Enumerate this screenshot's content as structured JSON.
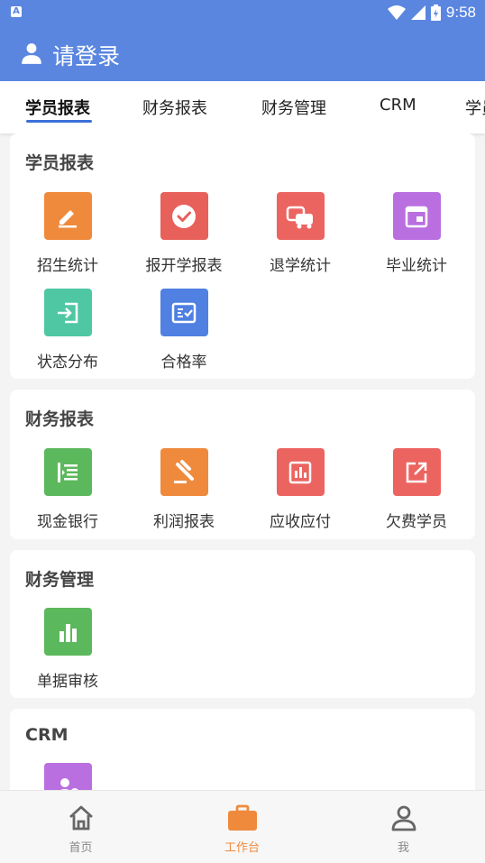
{
  "status_bar": {
    "time": "9:58",
    "notification_badge": "A"
  },
  "header": {
    "title": "请登录"
  },
  "tabs": [
    {
      "label": "学员报表",
      "active": true
    },
    {
      "label": "财务报表"
    },
    {
      "label": "财务管理"
    },
    {
      "label": "CRM"
    },
    {
      "label": "学员"
    }
  ],
  "sections": [
    {
      "title": "学员报表",
      "items": [
        {
          "label": "招生统计",
          "icon": "edit-icon",
          "color": "#ef8a3c"
        },
        {
          "label": "报开学报表",
          "icon": "check-circle-icon",
          "color": "#e8605a"
        },
        {
          "label": "退学统计",
          "icon": "vehicles-icon",
          "color": "#ec6460"
        },
        {
          "label": "毕业统计",
          "icon": "calendar-icon",
          "color": "#ba6fe0"
        },
        {
          "label": "状态分布",
          "icon": "login-arrow-icon",
          "color": "#4fc7a2"
        },
        {
          "label": "合格率",
          "icon": "checklist-icon",
          "color": "#4f80e2"
        }
      ]
    },
    {
      "title": "财务报表",
      "items": [
        {
          "label": "现金银行",
          "icon": "indent-list-icon",
          "color": "#5cb85c"
        },
        {
          "label": "利润报表",
          "icon": "gavel-icon",
          "color": "#ef8a3c"
        },
        {
          "label": "应收应付",
          "icon": "bar-chart-box-icon",
          "color": "#ec6460"
        },
        {
          "label": "欠费学员",
          "icon": "external-link-icon",
          "color": "#ec6460"
        }
      ]
    },
    {
      "title": "财务管理",
      "items": [
        {
          "label": "单据审核",
          "icon": "bar-chart-icon",
          "color": "#5cb85c"
        }
      ]
    },
    {
      "title": "CRM",
      "items": [
        {
          "label": "",
          "icon": "person-settings-icon",
          "color": "#ba6fe0"
        }
      ]
    }
  ],
  "bottom_nav": [
    {
      "label": "首页",
      "icon": "home-icon"
    },
    {
      "label": "工作台",
      "icon": "briefcase-icon",
      "active": true
    },
    {
      "label": "我",
      "icon": "person-icon"
    }
  ],
  "colors": {
    "primary": "#5a86e0",
    "active_tab_underline": "#3b6fd9",
    "active_nav": "#ef8a3c"
  }
}
